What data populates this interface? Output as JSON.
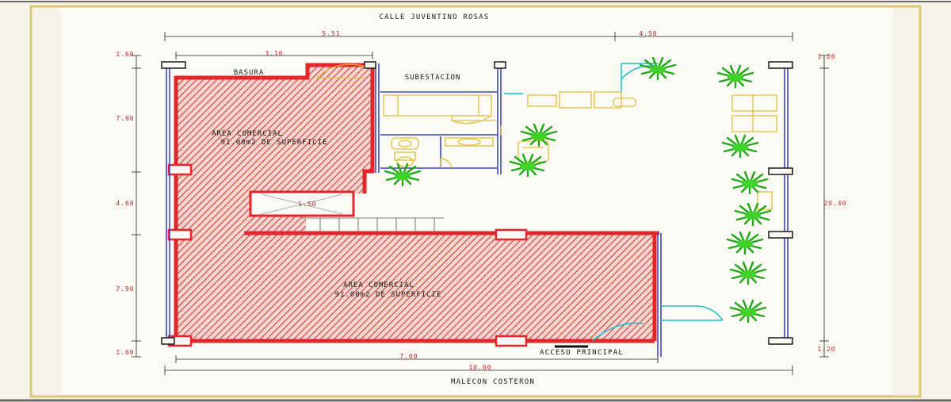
{
  "colors": {
    "background": "#f6f3e8",
    "frame": "#d9c77a",
    "wall": "#e2262b",
    "window": "#3b47c4",
    "fixture": "#e0bf3a",
    "door": "#19c0c8",
    "plant": "#2fbf1f",
    "dimension": "#c0262b"
  },
  "streets": {
    "top": "CALLE JUVENTINO ROSAS",
    "bottom": "MALECON COSTERON"
  },
  "rooms": {
    "basura": "BASURA",
    "subestacion": "SUBESTACION",
    "comercial_top": {
      "name": "AREA COMERCIAL",
      "area": "91.00m2 DE SUPERFICIE"
    },
    "comercial_bottom": {
      "name": "AREA COMERCIAL",
      "area": "91.00m2 DE SUPERFICIE"
    },
    "acceso": "ACCESO PRINCIPAL",
    "stair_width": "1.50"
  },
  "dimensions": {
    "top_left": "5.51",
    "top_right": "4.50",
    "inner_top": "3.16",
    "left_1": "1.60",
    "left_2": "7.90",
    "left_3": "4.60",
    "left_4": "7.90",
    "left_5": "1.60",
    "right_top": "1.20",
    "right_total": "20.40",
    "right_bottom": "1.20",
    "bottom_inner": "7.60",
    "bottom_total": "10.00"
  },
  "icons": [
    "plant-icon",
    "toilet-icon",
    "sink-icon",
    "sofa-icon",
    "desk-icon"
  ]
}
